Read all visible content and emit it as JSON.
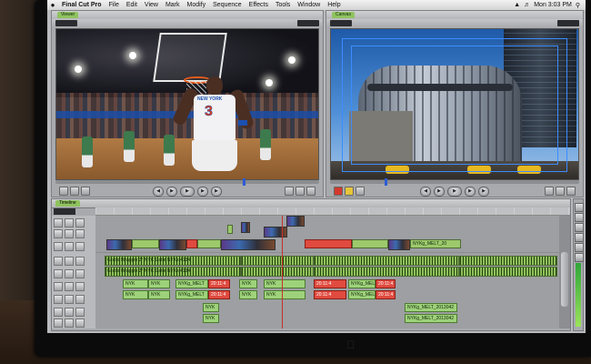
{
  "menubar": {
    "app": "Final Cut Pro",
    "items": [
      "File",
      "Edit",
      "View",
      "Mark",
      "Modify",
      "Sequence",
      "Effects",
      "Tools",
      "Window",
      "Help"
    ],
    "clock": "Mon 3:03 PM"
  },
  "viewer": {
    "tab": "Viewer",
    "jersey_team": "NEW YORK",
    "jersey_number": "3"
  },
  "canvas": {
    "tab": "Canvas"
  },
  "timeline": {
    "tab": "Timeline",
    "clip_labels": {
      "seq_clip": "NYKg_MELT_20",
      "audio_clip": "Gratis Wrappin 2° NYK Gatle NYKs 4134",
      "red_clip": "20:11:4",
      "nyk": "NYK",
      "nyk_melt": "NYKg_MELT",
      "nyk_melt_long": "NYKg_MELT_2013042"
    }
  },
  "colors": {
    "clip_green": "#9dc96c",
    "clip_red": "#e04a3f",
    "tab_green": "#8fc35f",
    "playhead_red": "#c8302a",
    "safe_area_blue": "#3c8cff"
  }
}
